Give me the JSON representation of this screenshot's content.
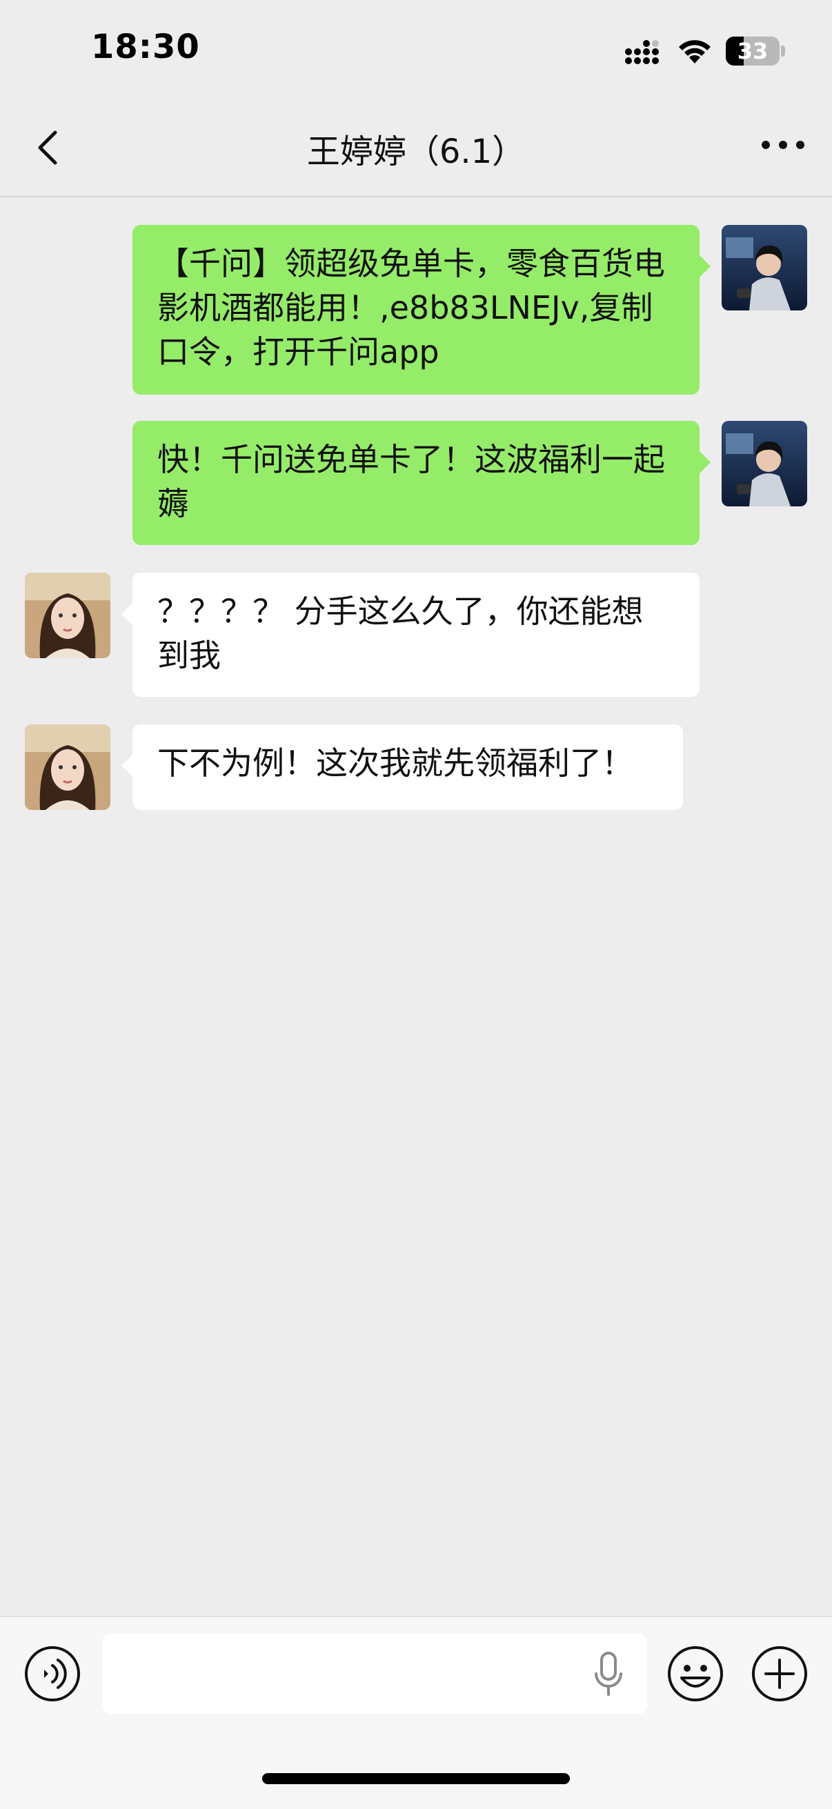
{
  "status_bar": {
    "time": "18:30",
    "battery_level": "33",
    "battery_fraction": 0.33,
    "icons": [
      "signal-icon",
      "wifi-icon",
      "battery-icon"
    ]
  },
  "nav": {
    "title": "王婷婷（6.1）",
    "icons": [
      "chevron-left-icon",
      "more-icon"
    ]
  },
  "messages": [
    {
      "direction": "outgoing",
      "text": "【千问】领超级免单卡，零食百货电影机酒都能用！,e8b83LNEJv,复制口令，打开千问app"
    },
    {
      "direction": "outgoing",
      "text": "快！千问送免单卡了！这波福利一起薅"
    },
    {
      "direction": "incoming",
      "text": "？？？？ 分手这么久了，你还能想到我"
    },
    {
      "direction": "incoming",
      "text": "下不为例！这次我就先领福利了！"
    }
  ],
  "input_bar": {
    "value": "",
    "icons": [
      "voice-icon",
      "mic-icon",
      "emoji-icon",
      "plus-icon"
    ]
  },
  "colors": {
    "background": "#ededed",
    "outgoing_bubble": "#95ec69",
    "incoming_bubble": "#ffffff",
    "input_bar": "#f7f7f7"
  }
}
